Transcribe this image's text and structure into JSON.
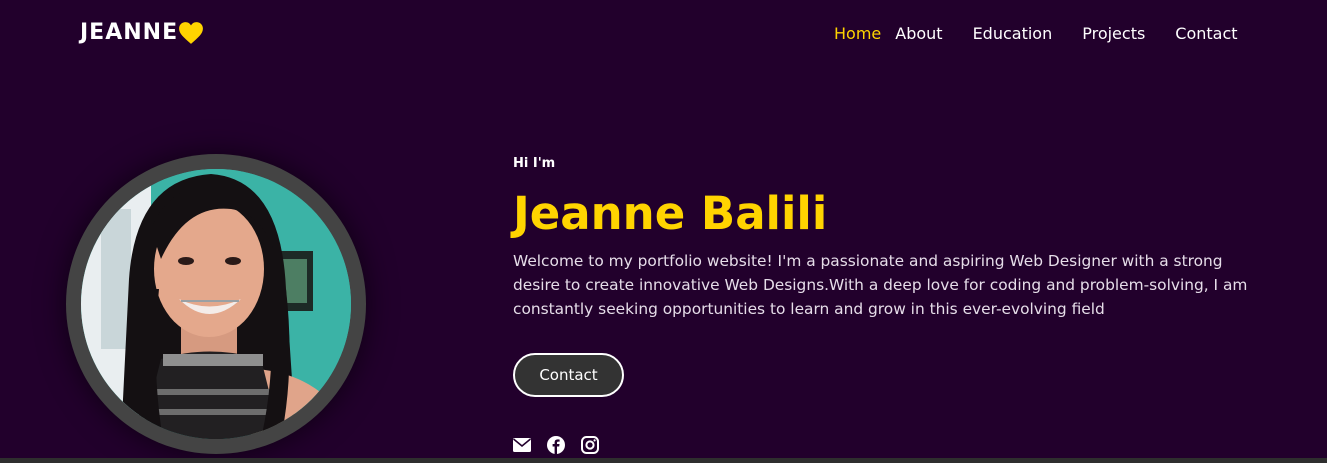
{
  "brand": {
    "logo_text": "JEANNE",
    "logo_icon": "heart-icon",
    "accent_color": "#ffd400",
    "background_color": "#22002c"
  },
  "nav": {
    "items": [
      {
        "label": "Home",
        "active": true
      },
      {
        "label": "About",
        "active": false
      },
      {
        "label": "Education",
        "active": false
      },
      {
        "label": "Projects",
        "active": false
      },
      {
        "label": "Contact",
        "active": false
      }
    ]
  },
  "hero": {
    "greeting": "Hi I'm",
    "name": "Jeanne Balili",
    "intro": "Welcome to my portfolio website! I'm a passionate and aspiring Web Designer with a strong desire to create innovative Web Designs.With a deep love for coding and problem-solving, I am constantly seeking opportunities to learn and grow in this ever-evolving field",
    "contact_button": "Contact",
    "social_icons": [
      "envelope-icon",
      "facebook-icon",
      "instagram-icon"
    ]
  }
}
